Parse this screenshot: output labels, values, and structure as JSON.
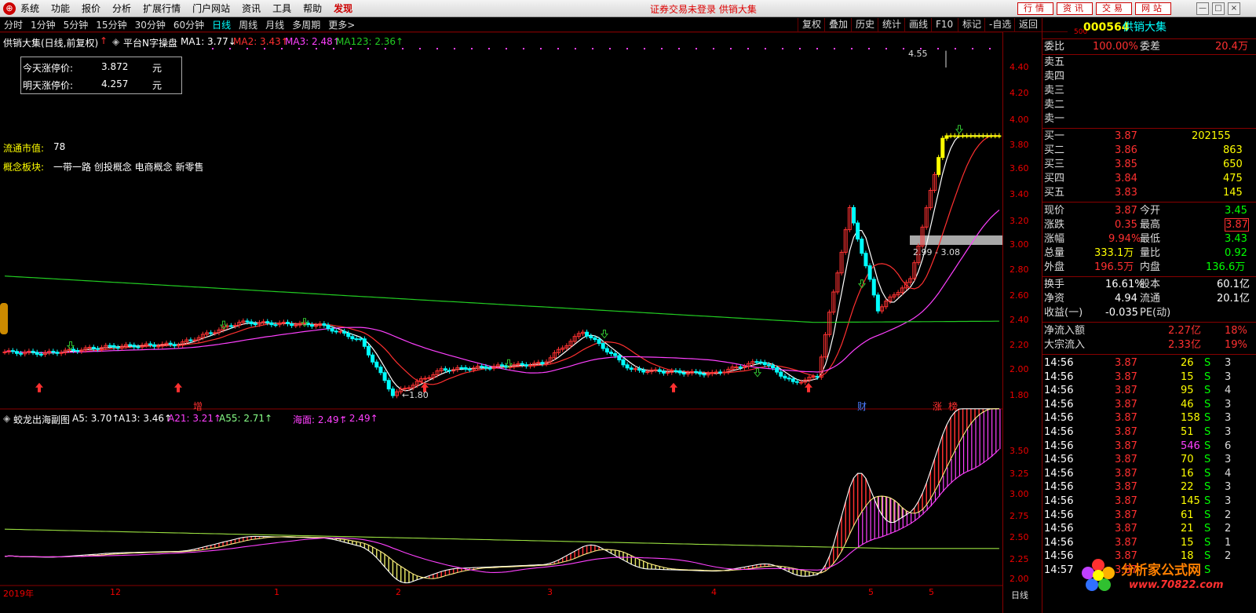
{
  "menu": {
    "logo": "⊕",
    "items": [
      "系统",
      "功能",
      "报价",
      "分析",
      "扩展行情",
      "门户网站",
      "资讯",
      "工具",
      "帮助"
    ],
    "hot": "发现",
    "notice": "证券交易未登录  供销大集",
    "right_buttons": [
      "行情",
      "资讯",
      "交易",
      "网站"
    ],
    "win": [
      "—",
      "□",
      "×"
    ]
  },
  "toolbar": {
    "periods": [
      "分时",
      "1分钟",
      "5分钟",
      "15分钟",
      "30分钟",
      "60分钟",
      "日线",
      "周线",
      "月线",
      "多周期",
      "更多>"
    ],
    "active": "日线",
    "functions": [
      "复权",
      "叠加",
      "历史",
      "统计",
      "画线",
      "F10",
      "标记",
      "-自选",
      "返回"
    ]
  },
  "main_title": {
    "stock": "供销大集(日线,前复权)",
    "indicator": "平台N字操盘",
    "ma1": "MA1: 3.77↓",
    "ma2": "MA2: 3.43↑",
    "ma3": "MA3: 2.48↑",
    "ma123": "MA123: 2.36↑"
  },
  "infobox": {
    "today_label": "今天涨停价:",
    "today_val": "3.872",
    "tomorrow_label": "明天涨停价:",
    "tomorrow_val": "4.257",
    "unit": "元"
  },
  "float_cap": {
    "label": "流通市值:",
    "value": "78"
  },
  "concept": {
    "label": "概念板块:",
    "value": "一带一路 创投概念 电商概念 新零售"
  },
  "annotations": {
    "high": "4.55",
    "low": "←1.80",
    "range": "2.99 - 3.08",
    "zeng": "增",
    "cai": "财",
    "zhang": "涨",
    "bang": "榜"
  },
  "sub_title": {
    "name": "蛟龙出海副图",
    "a5": "A5: 3.70↑",
    "a13": "A13: 3.46↑",
    "a21": "A21: 3.21↑",
    "a55": "A55: 2.71↑",
    "haimian": "海面: 2.49↑",
    "extra": ": 2.49↑"
  },
  "yaxis_main": [
    "4.40",
    "4.20",
    "4.00",
    "3.80",
    "3.60",
    "3.40",
    "3.20",
    "3.00",
    "2.80",
    "2.60",
    "2.40",
    "2.20",
    "2.00",
    "1.80"
  ],
  "yaxis_sub": [
    "3.50",
    "3.25",
    "3.00",
    "2.75",
    "2.50",
    "2.25",
    "2.00"
  ],
  "xaxis": [
    "2019年",
    "12",
    "1",
    "2",
    "3",
    "4",
    "5",
    "5"
  ],
  "xaxis_right": "日线",
  "colors": {
    "up": "#ff3232",
    "down": "#00ffff",
    "limit": "#ffff00",
    "ma1": "#ffffff",
    "ma2": "#ff3030",
    "ma3": "#ff40ff",
    "ma123": "#22cc22"
  },
  "quote": {
    "code": "000564",
    "name": "供销大集",
    "sup": "500",
    "wb": {
      "l1": "委比",
      "v1": "100.00%",
      "l2": "委差",
      "v2": "20.4万"
    },
    "sells": [
      "卖五",
      "卖四",
      "卖三",
      "卖二",
      "卖一"
    ],
    "buys": [
      [
        "买一",
        "3.87",
        "202155"
      ],
      [
        "买二",
        "3.86",
        "863"
      ],
      [
        "买三",
        "3.85",
        "650"
      ],
      [
        "买四",
        "3.84",
        "475"
      ],
      [
        "买五",
        "3.83",
        "145"
      ]
    ],
    "stats": [
      [
        "现价",
        "3.87",
        "今开",
        "3.45"
      ],
      [
        "涨跌",
        "0.35",
        "最高",
        "3.87"
      ],
      [
        "涨幅",
        "9.94%",
        "最低",
        "3.43"
      ],
      [
        "总量",
        "333.1万",
        "量比",
        "0.92"
      ],
      [
        "外盘",
        "196.5万",
        "内盘",
        "136.6万"
      ]
    ],
    "stats2": [
      [
        "换手",
        "16.61%",
        "股本",
        "60.1亿"
      ],
      [
        "净资",
        "4.94",
        "流通",
        "20.1亿"
      ],
      [
        "收益(一)",
        "-0.035",
        "PE(动)",
        ""
      ]
    ],
    "flows": [
      [
        "净流入额",
        "2.27亿",
        "18%"
      ],
      [
        "大宗流入",
        "2.33亿",
        "19%"
      ]
    ],
    "ticks": [
      [
        "14:56",
        "3.87",
        "26",
        "S",
        "3"
      ],
      [
        "14:56",
        "3.87",
        "15",
        "S",
        "3"
      ],
      [
        "14:56",
        "3.87",
        "95",
        "S",
        "4"
      ],
      [
        "14:56",
        "3.87",
        "46",
        "S",
        "3"
      ],
      [
        "14:56",
        "3.87",
        "158",
        "S",
        "3"
      ],
      [
        "14:56",
        "3.87",
        "51",
        "S",
        "3"
      ],
      [
        "14:56",
        "3.87",
        "546",
        "S",
        "6"
      ],
      [
        "14:56",
        "3.87",
        "70",
        "S",
        "3"
      ],
      [
        "14:56",
        "3.87",
        "16",
        "S",
        "4"
      ],
      [
        "14:56",
        "3.87",
        "22",
        "S",
        "3"
      ],
      [
        "14:56",
        "3.87",
        "145",
        "S",
        "3"
      ],
      [
        "14:56",
        "3.87",
        "61",
        "S",
        "2"
      ],
      [
        "14:56",
        "3.87",
        "21",
        "S",
        "2"
      ],
      [
        "14:56",
        "3.87",
        "15",
        "S",
        "1"
      ],
      [
        "14:56",
        "3.87",
        "18",
        "S",
        "2"
      ],
      [
        "14:57",
        "3.87",
        "",
        "S",
        ""
      ]
    ]
  },
  "watermark": {
    "text": "分析家公式网",
    "url": "www.70822.com"
  }
}
